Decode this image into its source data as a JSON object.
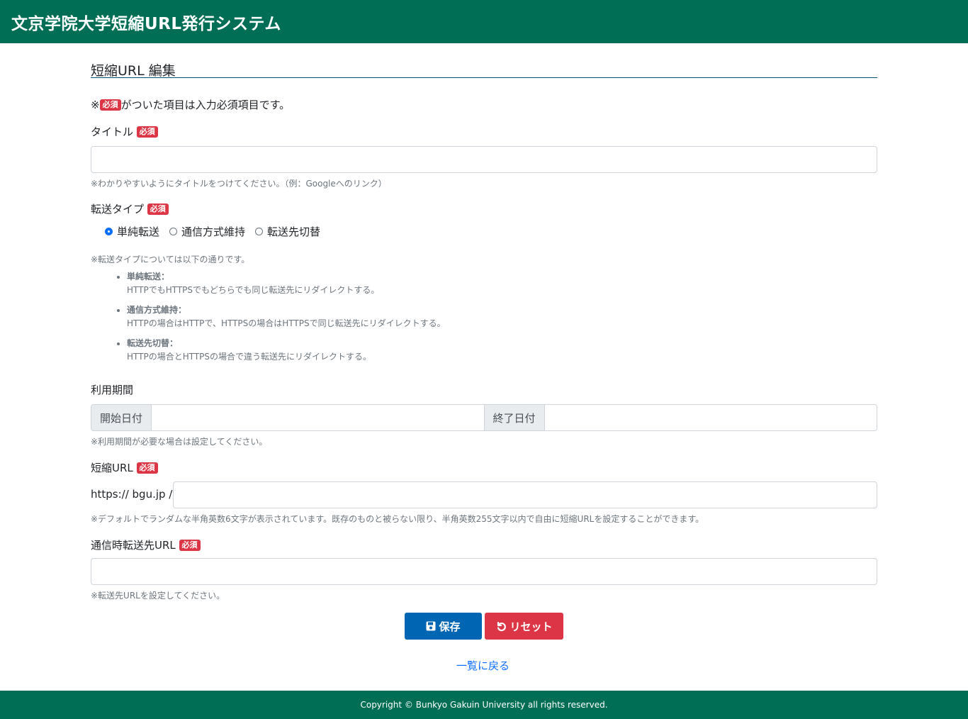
{
  "header": {
    "title": "文京学院大学短縮URL発行システム"
  },
  "page": {
    "title": "短縮URL 編集",
    "required_note_prefix": "※",
    "required_note_suffix": "がついた項目は入力必須項目です。"
  },
  "badge": "必須",
  "fields": {
    "title": {
      "label": "タイトル",
      "value": "",
      "help": "※わかりやすいようにタイトルをつけてください。（例：Googleへのリンク）"
    },
    "transfer_type": {
      "label": "転送タイプ",
      "options": [
        "単純転送",
        "通信方式維持",
        "転送先切替"
      ],
      "selected": "単純転送",
      "help_intro": "※転送タイプについては以下の通りです。",
      "descriptions": [
        {
          "term": "単純転送：",
          "desc": "HTTPでもHTTPSでもどちらでも同じ転送先にリダイレクトする。"
        },
        {
          "term": "通信方式維持：",
          "desc": "HTTPの場合はHTTPで、HTTPSの場合はHTTPSで同じ転送先にリダイレクトする。"
        },
        {
          "term": "転送先切替：",
          "desc": "HTTPの場合とHTTPSの場合で違う転送先にリダイレクトする。"
        }
      ]
    },
    "period": {
      "label": "利用期間",
      "start_label": "開始日付",
      "end_label": "終了日付",
      "start_value": "",
      "end_value": "",
      "help": "※利用期間が必要な場合は設定してください。"
    },
    "short_url": {
      "label": "短縮URL",
      "prefix": "https:// bgu.jp /",
      "value": "",
      "help": "※デフォルトでランダムな半角英数6文字が表示されています。既存のものと被らない限り、半角英数255文字以内で自由に短縮URLを設定することができます。"
    },
    "redirect_url": {
      "label": "通信時転送先URL",
      "value": "",
      "help": "※転送先URLを設定してください。"
    }
  },
  "buttons": {
    "save": "保存",
    "reset": "リセット"
  },
  "back_link": "一覧に戻る",
  "footer": {
    "copyright": "Copyright © Bunkyo Gakuin University all rights reserved."
  },
  "colors": {
    "header_bg": "#006e55",
    "badge_bg": "#dc3545",
    "save_bg": "#0065b3",
    "reset_bg": "#dc3545",
    "link": "#0d6efd"
  },
  "icons": {
    "save": "floppy-disk-icon",
    "reset": "undo-icon"
  }
}
